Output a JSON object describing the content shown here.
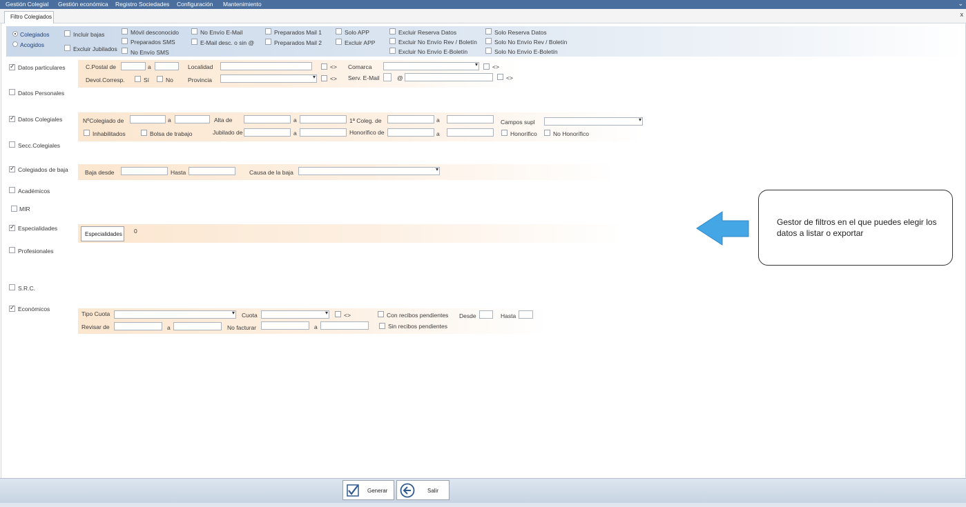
{
  "menu": [
    "Gestión Colegial",
    "Gestión económica",
    "Registro Sociedades",
    "Configuración",
    "Mantenimiento"
  ],
  "tab": {
    "label": "Filtro Colegiados",
    "close": "x"
  },
  "top_options": {
    "radio_colegiados": "Colegiados",
    "radio_acogidos": "Acogidos",
    "incluir_bajas": "Incluir bajas",
    "excluir_jubilados": "Excluir Jubilados",
    "movil_desconocido": "Móvil desconocido",
    "preparados_sms": "Preparados SMS",
    "no_envio_sms": "No Envío SMS",
    "no_envio_email": "No Envío E-Mail",
    "email_desc": "E-Mail desc. o sin @",
    "preparados_mail1": "Preparados Mail 1",
    "preparados_mail2": "Preparados Mail 2",
    "solo_app": "Solo APP",
    "excluir_app": "Excluir APP",
    "excluir_reserva": "Excluir Reserva Datos",
    "excluir_no_envio_rev": "Excluir No Envío Rev / Boletín",
    "excluir_no_envio_eboletin": "Excluir No Envío E-Boletín",
    "solo_reserva": "Solo Reserva Datos",
    "solo_no_envio_rev": "Solo No Envío Rev / Boletín",
    "solo_no_envio_eboletin": "Solo No Envío E-Boletín"
  },
  "sections": {
    "datos_particulares": "Datos particulares",
    "datos_personales": "Datos Personales",
    "datos_colegiales": "Datos Colegiales",
    "secc_colegiales": "Secc.Colegiales",
    "colegiados_baja": "Colegiados de baja",
    "academicos": "Académicos",
    "mir": "MIR",
    "especialidades": "Especialidades",
    "profesionales": "Profesionales",
    "src": "S.R.C.",
    "economicos": "Económicos"
  },
  "particulares": {
    "cpostal": "C.Postal de",
    "a": "a",
    "localidad": "Localidad",
    "neq": "<>",
    "comarca": "Comarca",
    "devol": "Devol.Corresp.",
    "si": "Sí",
    "no": "No",
    "provincia": "Provincia",
    "serv_email": "Serv. E-Mail",
    "at": "@"
  },
  "colegiales": {
    "ncolegiado": "NºColegiado de",
    "a": "a",
    "alta": "Alta de",
    "primera_coleg": "1ª Coleg. de",
    "campos_supl": "Campos supl",
    "inhabilitados": "Inhabilitados",
    "bolsa": "Bolsa de trabajo",
    "jubilado": "Jubilado de",
    "honorifico_de": "Honorífico de",
    "honorifico": "Honorífico",
    "no_honorifico": "No Honorífico"
  },
  "baja": {
    "desde": "Baja desde",
    "hasta": "Hasta",
    "causa": "Causa de la baja"
  },
  "especialidades": {
    "button": "Especialidades",
    "count": "0"
  },
  "economicos": {
    "tipo_cuota": "Tipo Cuota",
    "cuota": "Cuota",
    "neq": "<>",
    "con_recibos": "Con recibos pendientes",
    "desde": "Desde",
    "hasta": "Hasta",
    "revisar": "Revisar de",
    "a": "a",
    "no_facturar": "No facturar",
    "sin_recibos": "Sin recibos pendientes"
  },
  "callout": "Gestor de filtros en el que puedes elegir los datos a listar o exportar",
  "buttons": {
    "generar": "Generar",
    "salir": "Salir"
  },
  "colors": {
    "menubar": "#4a6f9e",
    "arrow": "#45a6e5",
    "band": "#fbe6cf",
    "topband": "#c9d8ea"
  }
}
